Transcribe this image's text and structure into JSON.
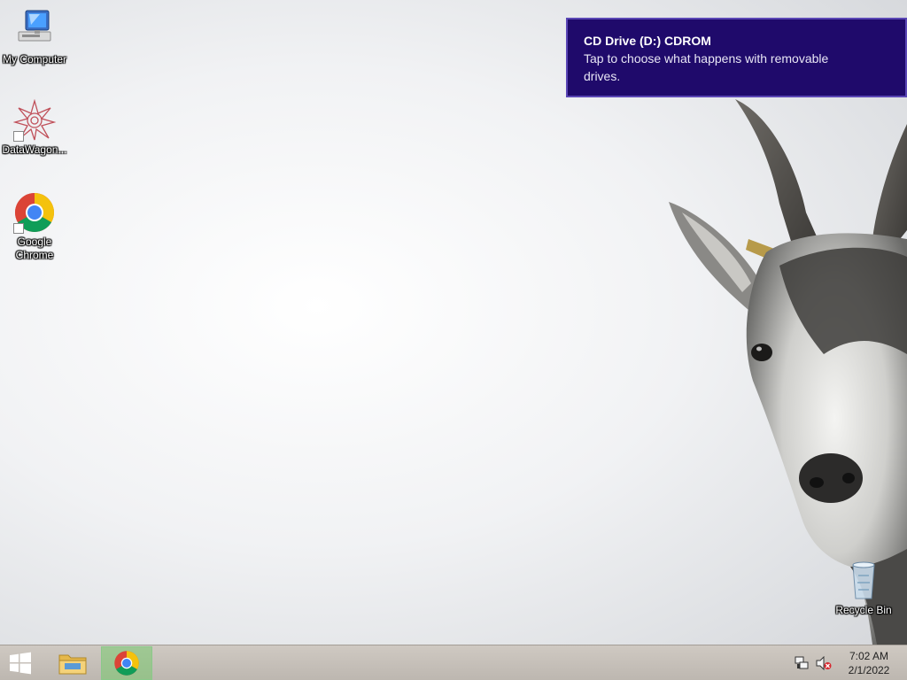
{
  "desktop": {
    "icons": [
      {
        "id": "my-computer",
        "label": "My Computer",
        "icon": "computer-monitor-icon"
      },
      {
        "id": "datawagon",
        "label": "DataWagon...",
        "icon": "datawagon-star-icon"
      },
      {
        "id": "google-chrome",
        "label": "Google Chrome",
        "icon": "chrome-icon"
      },
      {
        "id": "recycle-bin",
        "label": "Recycle Bin",
        "icon": "recycle-bin-icon"
      }
    ]
  },
  "notification": {
    "title": "CD Drive (D:) CDROM",
    "body": "Tap to choose what happens with removable drives.",
    "background": "#1f0a6b"
  },
  "taskbar": {
    "buttons": [
      {
        "name": "start",
        "icon": "windows-logo-icon"
      },
      {
        "name": "file-explorer",
        "icon": "folder-icon"
      },
      {
        "name": "chrome",
        "icon": "chrome-icon",
        "active": true
      }
    ],
    "tray": {
      "network_icon": "network-icon",
      "volume_icon": "volume-muted-icon",
      "time": "7:02 AM",
      "date": "2/1/2022"
    }
  },
  "colors": {
    "taskbar": "#c8c2bb",
    "active_task": "#8bc98a",
    "toast_border": "#5a46b5"
  }
}
